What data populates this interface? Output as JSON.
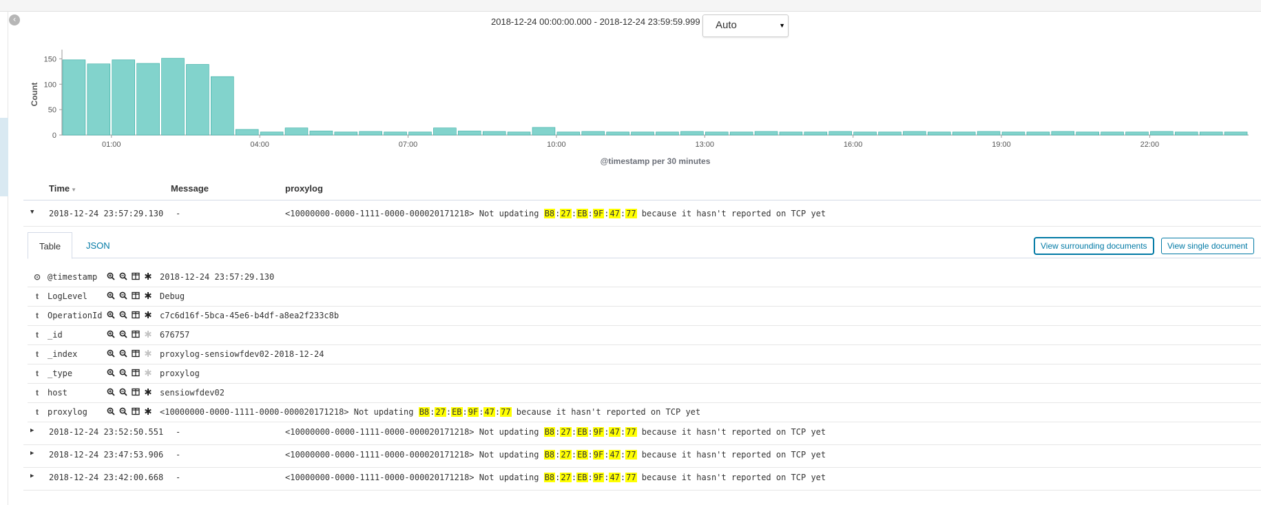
{
  "time_range": "2018-12-24 00:00:00.000 - 2018-12-24 23:59:59.999 —",
  "interval": {
    "selected": "Auto"
  },
  "chart_data": {
    "type": "bar",
    "ylabel": "Count",
    "xlabel": "@timestamp per 30 minutes",
    "ylim": [
      0,
      160
    ],
    "yticks": [
      "0",
      "50",
      "100",
      "150"
    ],
    "xtick_labels": [
      "01:00",
      "04:00",
      "07:00",
      "10:00",
      "13:00",
      "16:00",
      "19:00",
      "22:00"
    ],
    "values": [
      148,
      140,
      148,
      141,
      151,
      139,
      115,
      11,
      6,
      14,
      8,
      6,
      7,
      6,
      6,
      14,
      8,
      7,
      6,
      15,
      6,
      7,
      6,
      6,
      6,
      7,
      6,
      6,
      7,
      6,
      6,
      7,
      6,
      6,
      7,
      6,
      6,
      7,
      6,
      6,
      7,
      6,
      6,
      6,
      7,
      6,
      6,
      6
    ],
    "color": "#82d3cc",
    "stroke": "#2fa99f"
  },
  "table": {
    "columns": {
      "time": "Time",
      "message": "Message",
      "proxylog": "proxylog"
    },
    "rows": [
      {
        "time": "2018-12-24 23:57:29.130",
        "message": "-",
        "prefix": "<10000000-0000-1111-0000-000020171218> Not updating ",
        "mac": [
          "B8",
          "27",
          "EB",
          "9F",
          "47",
          "77"
        ],
        "suffix": " because it hasn't reported on TCP yet",
        "expanded": true
      },
      {
        "time": "2018-12-24 23:52:50.551",
        "message": "-",
        "prefix": "<10000000-0000-1111-0000-000020171218> Not updating ",
        "mac": [
          "B8",
          "27",
          "EB",
          "9F",
          "47",
          "77"
        ],
        "suffix": " because it hasn't reported on TCP yet",
        "expanded": false
      },
      {
        "time": "2018-12-24 23:47:53.906",
        "message": "-",
        "prefix": "<10000000-0000-1111-0000-000020171218> Not updating ",
        "mac": [
          "B8",
          "27",
          "EB",
          "9F",
          "47",
          "77"
        ],
        "suffix": " because it hasn't reported on TCP yet",
        "expanded": false
      },
      {
        "time": "2018-12-24 23:42:00.668",
        "message": "-",
        "prefix": "<10000000-0000-1111-0000-000020171218> Not updating ",
        "mac": [
          "B8",
          "27",
          "EB",
          "9F",
          "47",
          "77"
        ],
        "suffix": " because it hasn't reported on TCP yet",
        "expanded": false
      }
    ]
  },
  "detail": {
    "tabs": [
      "Table",
      "JSON"
    ],
    "view_surrounding": "View surrounding documents",
    "view_single": "View single document",
    "fields": [
      {
        "type": "⊙",
        "name": "@timestamp",
        "value": "2018-12-24 23:57:29.130"
      },
      {
        "type": "t",
        "name": "LogLevel",
        "value": "Debug"
      },
      {
        "type": "t",
        "name": "OperationId",
        "value": "c7c6d16f-5bca-45e6-b4df-a8ea2f233c8b"
      },
      {
        "type": "t",
        "name": "_id",
        "value": "676757"
      },
      {
        "type": "t",
        "name": "_index",
        "value": "proxylog-sensiowfdev02-2018-12-24"
      },
      {
        "type": "t",
        "name": "_type",
        "value": "proxylog"
      },
      {
        "type": "t",
        "name": "host",
        "value": "sensiowfdev02"
      },
      {
        "type": "t",
        "name": "proxylog",
        "prefix": "<10000000-0000-1111-0000-000020171218> Not updating ",
        "mac": [
          "B8",
          "27",
          "EB",
          "9F",
          "47",
          "77"
        ],
        "suffix": " because it hasn't reported on TCP yet"
      }
    ]
  }
}
